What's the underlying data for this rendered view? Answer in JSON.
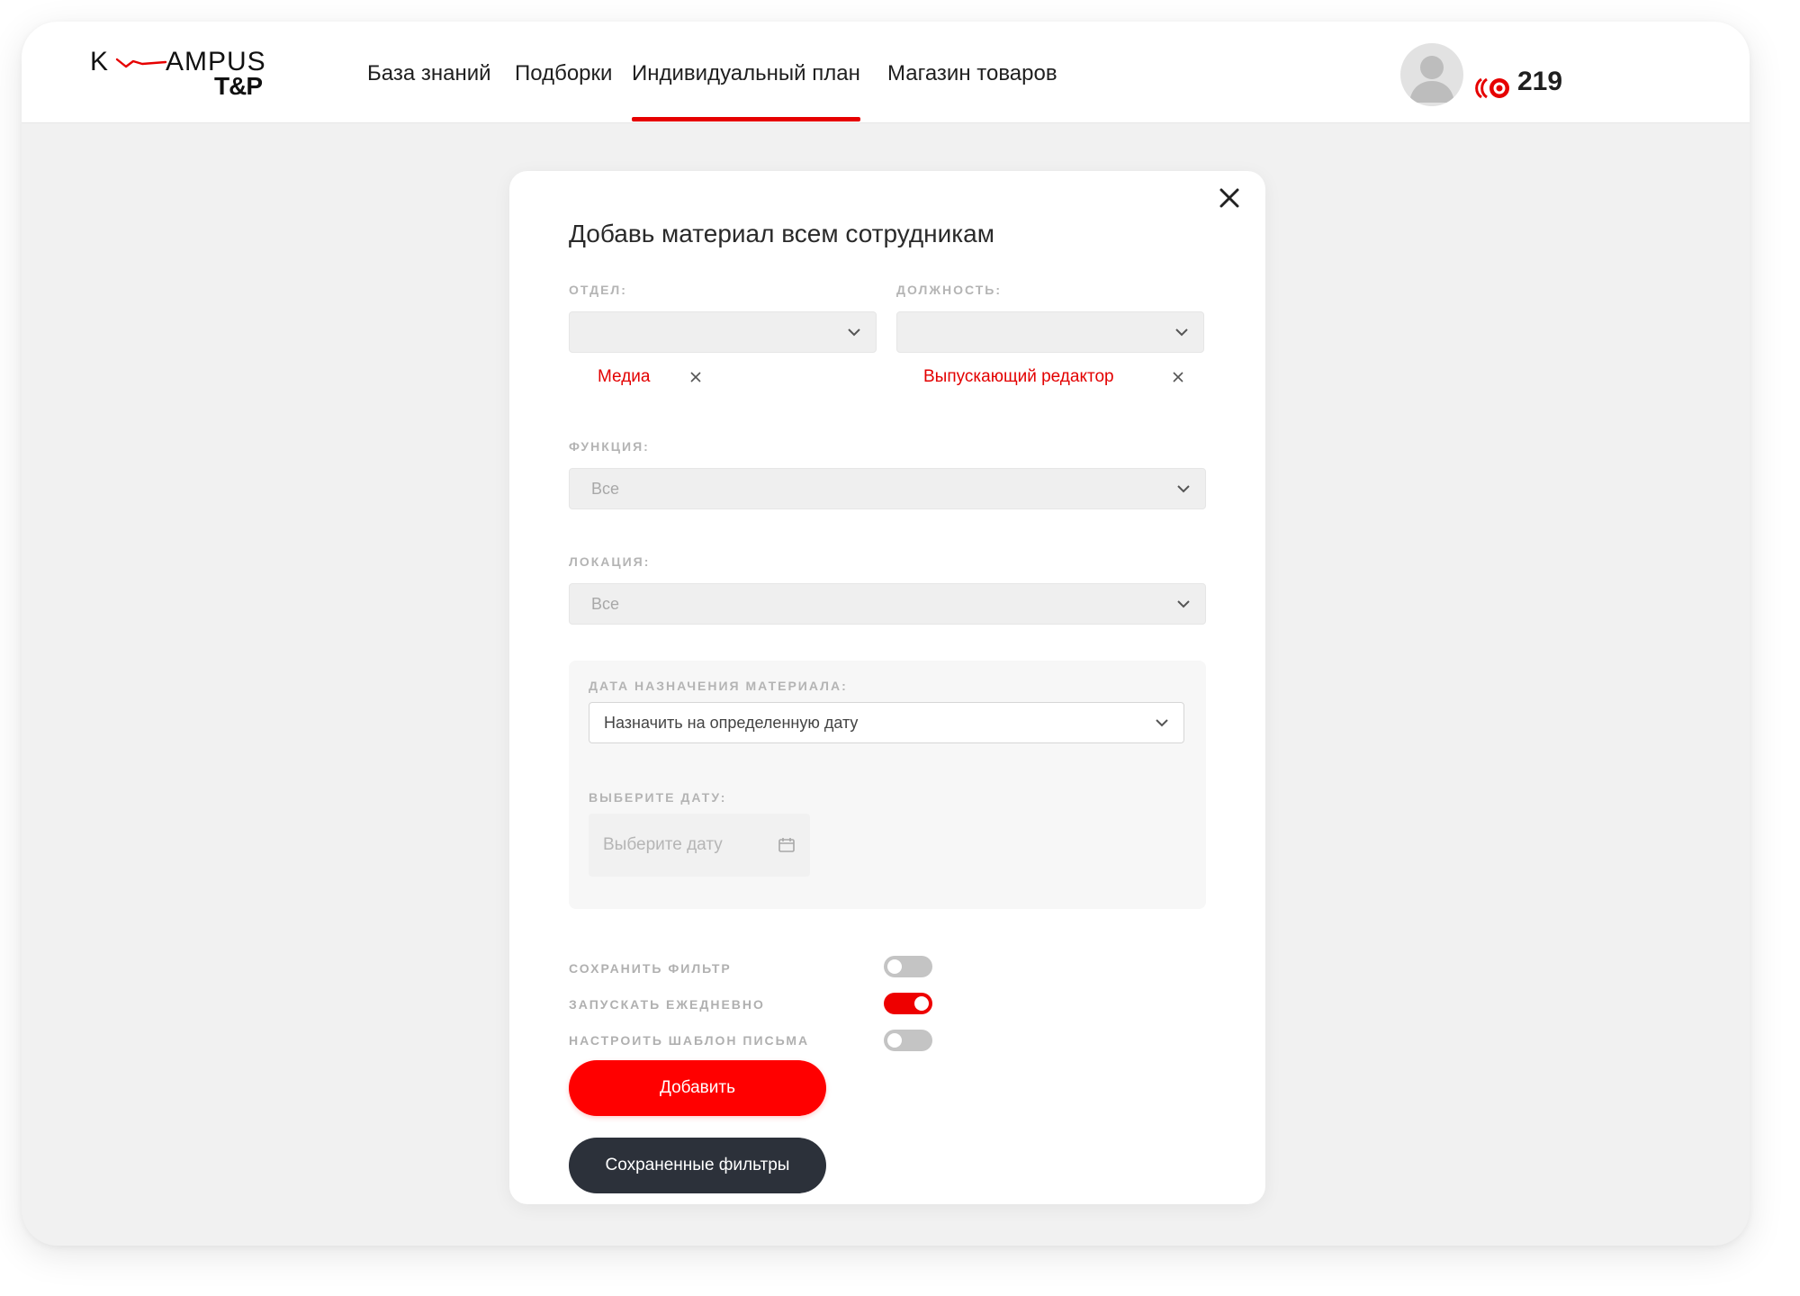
{
  "colors": {
    "accent": "#ff0000",
    "dark_button": "#2c313a",
    "tag_text": "#e30000"
  },
  "header": {
    "logo": {
      "line1_left": "K",
      "line1_right": "AMPUS",
      "line2": "T&P"
    },
    "nav": [
      {
        "label": "База знаний",
        "active": false
      },
      {
        "label": "Подборки",
        "active": false
      },
      {
        "label": "Индивидуальный план",
        "active": true
      },
      {
        "label": "Магазин товаров",
        "active": false
      }
    ],
    "user": {
      "avatar_icon": "user-avatar-icon",
      "points_icon": "coin-waves-icon",
      "points": "219"
    }
  },
  "modal": {
    "title": "Добавь материал всем сотрудникам",
    "close_icon": "close-icon",
    "department": {
      "label": "ОТДЕЛ:",
      "value": "",
      "tags": [
        "Медиа"
      ]
    },
    "position": {
      "label": "ДОЛЖНОСТЬ:",
      "value": "",
      "tags": [
        "Выпускающий редактор"
      ]
    },
    "function": {
      "label": "ФУНКЦИЯ:",
      "value": "Все"
    },
    "location": {
      "label": "ЛОКАЦИЯ:",
      "value": "Все"
    },
    "assign_date": {
      "label": "ДАТА НАЗНАЧЕНИЯ МАТЕРИАЛА:",
      "value": "Назначить на определенную дату",
      "pick_label": "ВЫБЕРИТЕ ДАТУ:",
      "pick_placeholder": "Выберите дату",
      "calendar_icon": "calendar-icon"
    },
    "toggles": [
      {
        "label": "СОХРАНИТЬ ФИЛЬТР",
        "on": false
      },
      {
        "label": "ЗАПУСКАТЬ ЕЖЕДНЕВНО",
        "on": true
      },
      {
        "label": "НАСТРОИТЬ ШАБЛОН ПИСЬМА",
        "on": false
      }
    ],
    "add_button": "Добавить",
    "saved_filters_button": "Сохраненные фильтры"
  }
}
